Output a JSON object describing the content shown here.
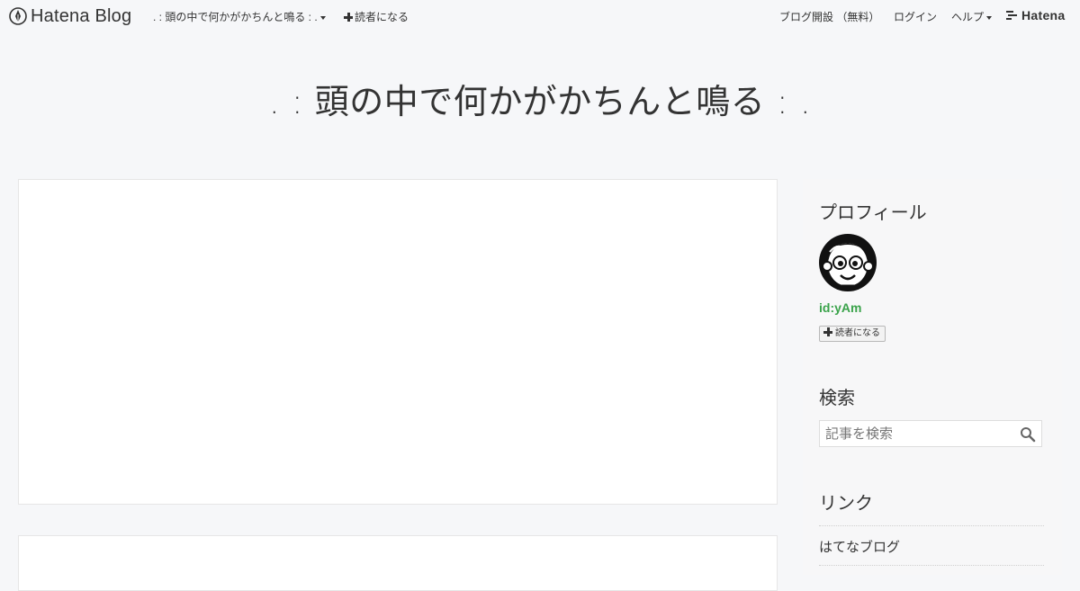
{
  "navbar": {
    "logo_text": "Hatena Blog",
    "blog_title": ". : 頭の中で何かがかちんと鳴る : .",
    "subscribe": "読者になる",
    "signup": "ブログ開設 （無料）",
    "login": "ログイン",
    "help": "ヘルプ",
    "hatena": "Hatena"
  },
  "header": {
    "title": ". : 頭の中で何かがかちんと鳴る : ."
  },
  "sidebar": {
    "profile": {
      "title": "プロフィール",
      "user_id": "id:yAm",
      "subscribe_label": "読者になる"
    },
    "search": {
      "title": "検索",
      "placeholder": "記事を検索"
    },
    "links": {
      "title": "リンク",
      "items": [
        {
          "label": "はてなブログ"
        }
      ]
    }
  },
  "colors": {
    "background": "#f6f7f9",
    "user_id_green": "#3aa34a",
    "text": "#333333"
  }
}
